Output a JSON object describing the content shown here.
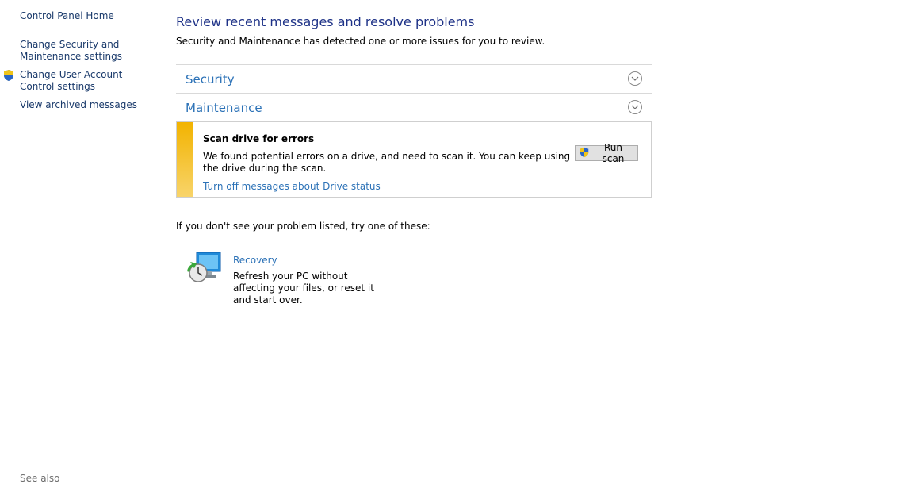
{
  "sidebar": {
    "home": "Control Panel Home",
    "security_settings": "Change Security and Maintenance settings",
    "uac_settings": "Change User Account Control settings",
    "archived": "View archived messages",
    "see_also": "See also"
  },
  "main": {
    "title": "Review recent messages and resolve problems",
    "description": "Security and Maintenance has detected one or more issues for you to review.",
    "sections": [
      {
        "label": "Security"
      },
      {
        "label": "Maintenance"
      }
    ],
    "alert": {
      "title": "Scan drive for errors",
      "text": "We found potential errors on a drive, and need to scan it. You can keep using the drive during the scan.",
      "link": "Turn off messages about Drive status",
      "button": "Run scan",
      "stripe_color": "#f2b300"
    },
    "try_text": "If you don't see your problem listed, try one of these:",
    "recovery": {
      "label": "Recovery",
      "description": "Refresh your PC without affecting your files, or reset it and start over."
    }
  },
  "colors": {
    "title": "#1e3287",
    "link": "#2c72b7",
    "sidebar_link": "#1a3a6b"
  }
}
